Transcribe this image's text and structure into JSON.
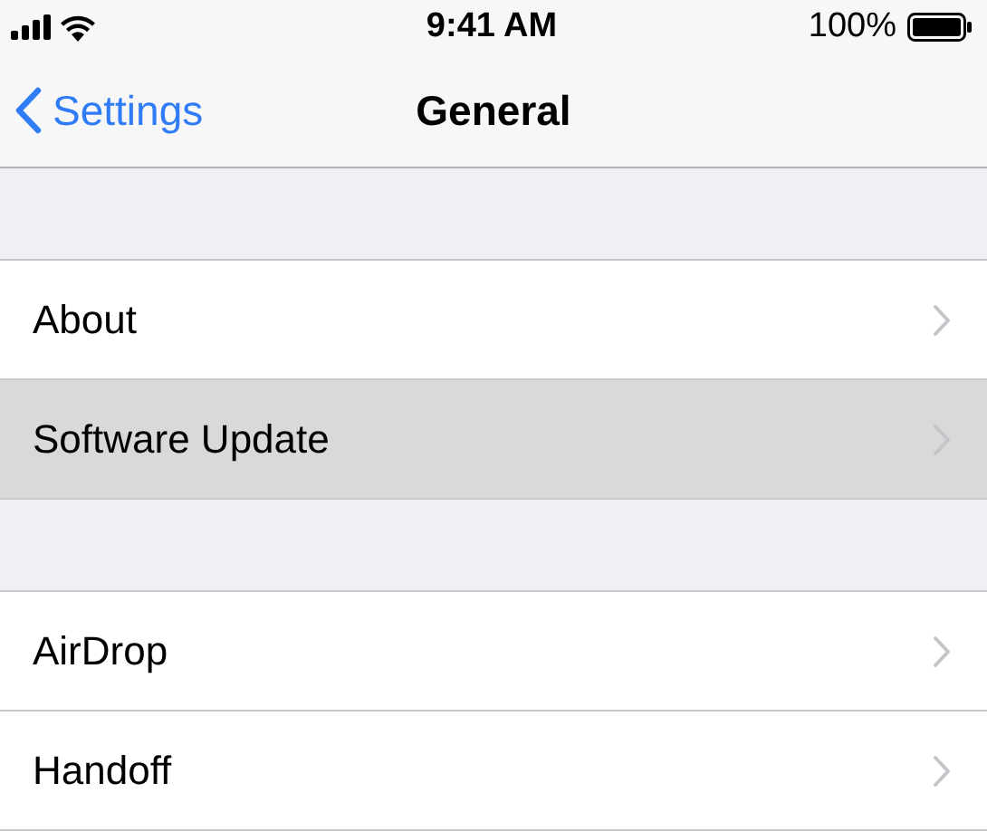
{
  "status_bar": {
    "time": "9:41 AM",
    "battery_percent": "100%"
  },
  "nav": {
    "back": "Settings",
    "title": "General"
  },
  "sections": [
    {
      "rows": [
        {
          "label": "About",
          "selected": false
        },
        {
          "label": "Software Update",
          "selected": true
        }
      ]
    },
    {
      "rows": [
        {
          "label": "AirDrop",
          "selected": false
        },
        {
          "label": "Handoff",
          "selected": false
        }
      ]
    }
  ]
}
